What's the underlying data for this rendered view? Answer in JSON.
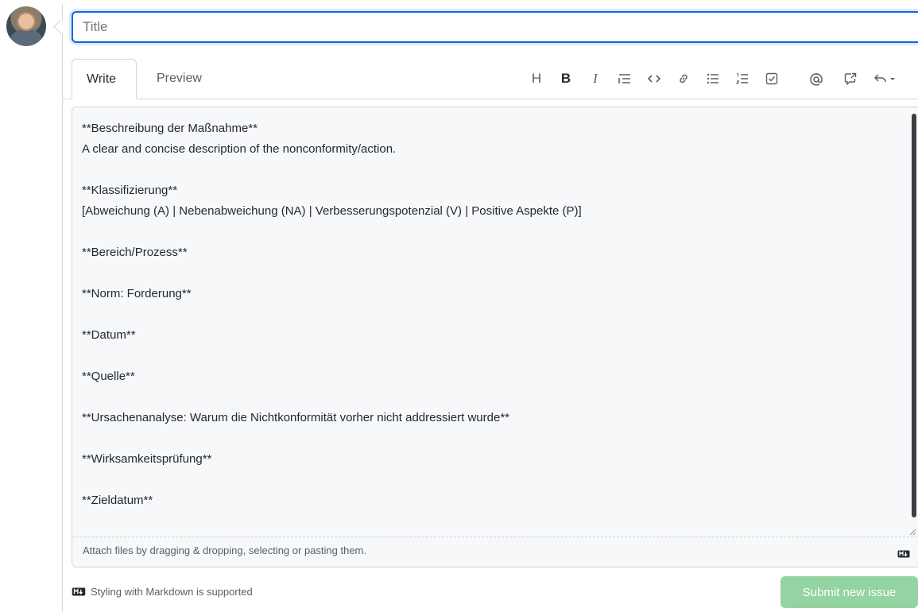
{
  "title_input": {
    "placeholder": "Title",
    "value": ""
  },
  "tabs": {
    "write": "Write",
    "preview": "Preview"
  },
  "toolbar": {
    "heading": "H",
    "bold": "B",
    "italic": "I"
  },
  "editor": {
    "lines": [
      "**Beschreibung der Maßnahme**",
      "A clear and concise description of the nonconformity/action.",
      "",
      "**Klassifizierung**",
      "[Abweichung (A) | Nebenabweichung (NA) | Verbesserungspotenzial (V) | Positive Aspekte (P)]",
      "",
      "**Bereich/Prozess**",
      "",
      "**Norm: Forderung**",
      "",
      "**Datum**",
      "",
      "**Quelle**",
      "",
      "**Ursachenanalyse: Warum die Nichtkonformität vorher nicht addressiert wurde**",
      "",
      "**Wirksamkeitsprüfung**",
      "",
      "**Zieldatum**"
    ],
    "attach_hint": "Attach files by dragging & dropping, selecting or pasting them."
  },
  "footer": {
    "markdown_note": "Styling with Markdown is supported",
    "submit_label": "Submit new issue"
  },
  "colors": {
    "accent": "#0969da",
    "submit_disabled": "#94d3a2",
    "border": "#d0d7de"
  }
}
